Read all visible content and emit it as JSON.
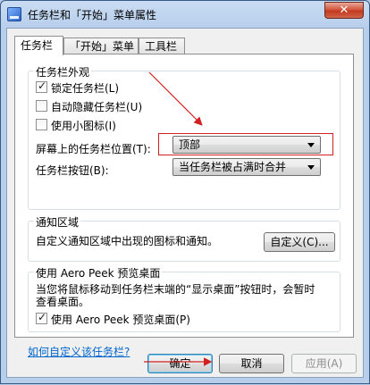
{
  "window": {
    "title": "任务栏和「开始」菜单属性",
    "close_label": "✕"
  },
  "tabs": [
    {
      "label": "任务栏",
      "active": true
    },
    {
      "label": "「开始」菜单",
      "active": false
    },
    {
      "label": "工具栏",
      "active": false
    }
  ],
  "appearance": {
    "label": "任务栏外观",
    "lock": {
      "label": "锁定任务栏(L)",
      "checked": true
    },
    "autohide": {
      "label": "自动隐藏任务栏(U)",
      "checked": false
    },
    "small_icons": {
      "label": "使用小图标(I)",
      "checked": false
    },
    "position": {
      "label": "屏幕上的任务栏位置(T):",
      "value": "顶部"
    },
    "buttons": {
      "label": "任务栏按钮(B):",
      "value": "当任务栏被占满时合并"
    }
  },
  "notification": {
    "label": "通知区域",
    "description": "自定义通知区域中出现的图标和通知。",
    "customize_label": "自定义(C)..."
  },
  "aero_peek": {
    "label": "使用 Aero Peek 预览桌面",
    "description_line1": "当您将鼠标移动到任务栏末端的“显示桌面”按钮时，会暂时",
    "description_line2": "查看桌面。",
    "checkbox": {
      "label": "使用 Aero Peek 预览桌面(P)",
      "checked": true
    }
  },
  "help_link": "如何自定义该任务栏?",
  "footer": {
    "ok_label": "确定",
    "cancel_label": "取消",
    "apply_label": "应用(A)"
  },
  "colors": {
    "annotation": "#d02020",
    "link": "#0066cc"
  }
}
